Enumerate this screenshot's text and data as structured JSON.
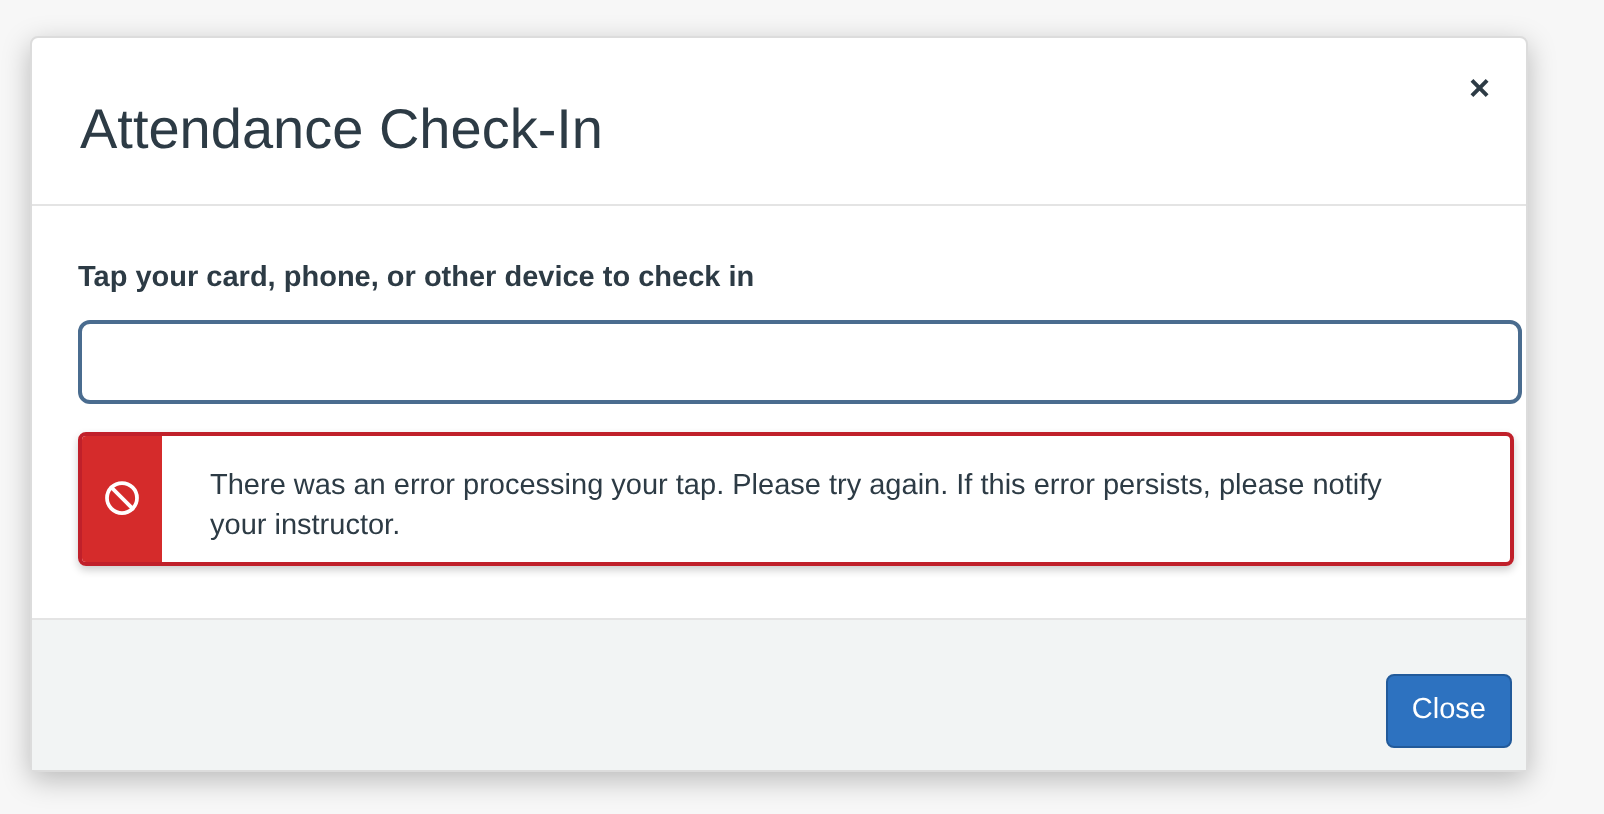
{
  "dialog": {
    "title": "Attendance Check-In",
    "close_symbol": "×"
  },
  "field": {
    "label": "Tap your card, phone, or other device to check in"
  },
  "alert": {
    "kind": "error",
    "message": "There was an error processing your tap. Please try again. If this error persists, please notify your instructor."
  },
  "buttons": [
    {
      "label": "Close"
    }
  ]
}
